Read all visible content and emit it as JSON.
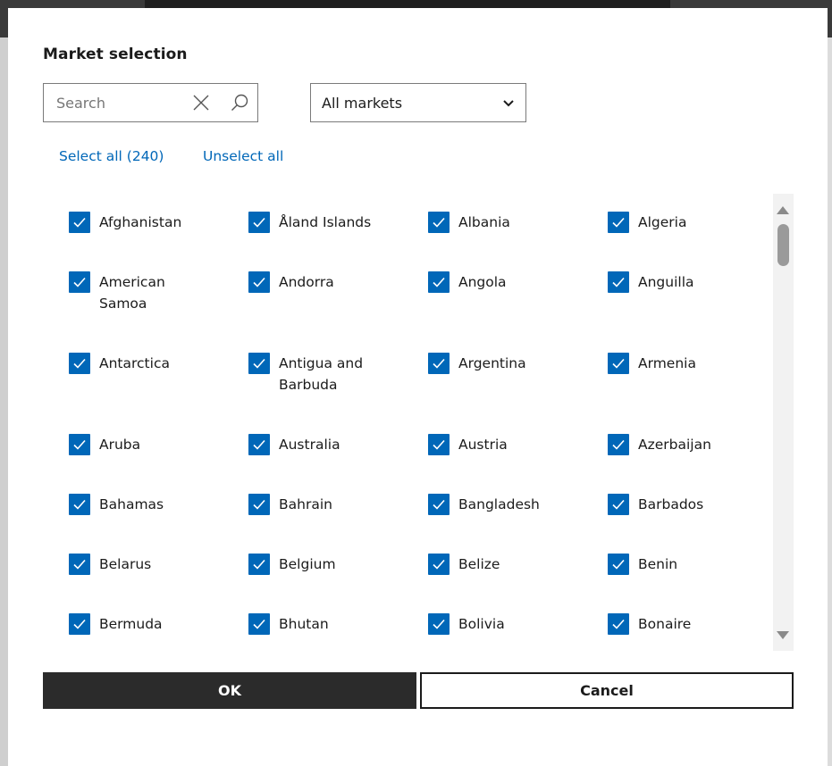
{
  "dialog": {
    "title": "Market selection",
    "search": {
      "placeholder": "Search",
      "value": ""
    },
    "market_filter": {
      "selected": "All markets"
    },
    "select_all_label": "Select all (240)",
    "unselect_all_label": "Unselect all",
    "markets": [
      {
        "label": "Afghanistan",
        "checked": true
      },
      {
        "label": "Åland Islands",
        "checked": true
      },
      {
        "label": "Albania",
        "checked": true
      },
      {
        "label": "Algeria",
        "checked": true
      },
      {
        "label": "American Samoa",
        "checked": true
      },
      {
        "label": "Andorra",
        "checked": true
      },
      {
        "label": "Angola",
        "checked": true
      },
      {
        "label": "Anguilla",
        "checked": true
      },
      {
        "label": "Antarctica",
        "checked": true
      },
      {
        "label": "Antigua and Barbuda",
        "checked": true
      },
      {
        "label": "Argentina",
        "checked": true
      },
      {
        "label": "Armenia",
        "checked": true
      },
      {
        "label": "Aruba",
        "checked": true
      },
      {
        "label": "Australia",
        "checked": true
      },
      {
        "label": "Austria",
        "checked": true
      },
      {
        "label": "Azerbaijan",
        "checked": true
      },
      {
        "label": "Bahamas",
        "checked": true
      },
      {
        "label": "Bahrain",
        "checked": true
      },
      {
        "label": "Bangladesh",
        "checked": true
      },
      {
        "label": "Barbados",
        "checked": true
      },
      {
        "label": "Belarus",
        "checked": true
      },
      {
        "label": "Belgium",
        "checked": true
      },
      {
        "label": "Belize",
        "checked": true
      },
      {
        "label": "Benin",
        "checked": true
      },
      {
        "label": "Bermuda",
        "checked": true
      },
      {
        "label": "Bhutan",
        "checked": true
      },
      {
        "label": "Bolivia",
        "checked": true
      },
      {
        "label": "Bonaire",
        "checked": true
      }
    ],
    "ok_label": "OK",
    "cancel_label": "Cancel"
  },
  "colors": {
    "accent": "#0067b8",
    "primary_button": "#2b2b2b"
  }
}
